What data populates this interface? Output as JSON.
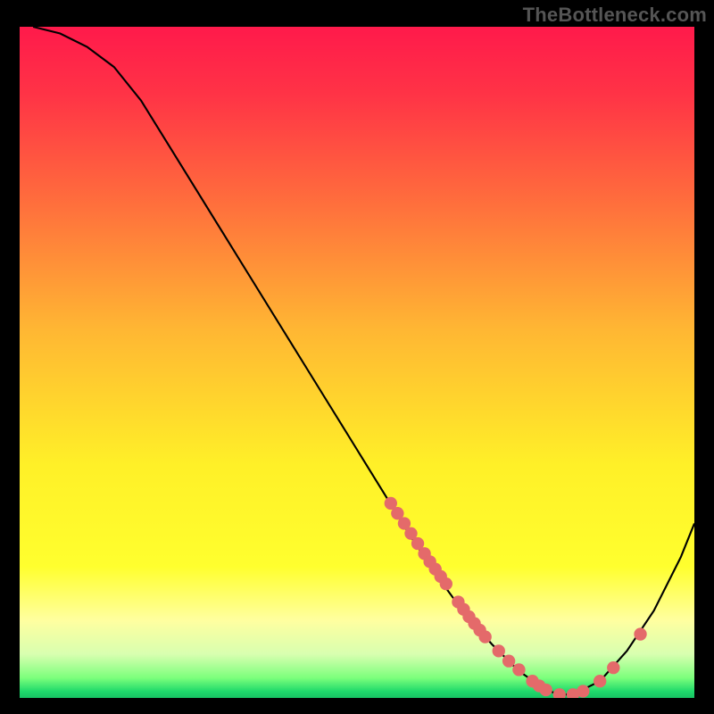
{
  "watermark": "TheBottleneck.com",
  "gradient_stops": [
    {
      "offset": 0.0,
      "color": "#ff1a4b"
    },
    {
      "offset": 0.1,
      "color": "#ff3346"
    },
    {
      "offset": 0.25,
      "color": "#ff6a3d"
    },
    {
      "offset": 0.45,
      "color": "#ffb733"
    },
    {
      "offset": 0.65,
      "color": "#fff028"
    },
    {
      "offset": 0.8,
      "color": "#ffff2e"
    },
    {
      "offset": 0.88,
      "color": "#ffffa0"
    },
    {
      "offset": 0.93,
      "color": "#d8ffb0"
    },
    {
      "offset": 0.965,
      "color": "#7cff7c"
    },
    {
      "offset": 0.985,
      "color": "#1fd96b"
    },
    {
      "offset": 1.0,
      "color": "#14b560"
    }
  ],
  "dot_color": "#e46a6a",
  "chart_data": {
    "type": "line",
    "title": "",
    "xlabel": "",
    "ylabel": "",
    "xlim": [
      0,
      100
    ],
    "ylim": [
      0,
      100
    ],
    "series": [
      {
        "name": "curve",
        "x": [
          2,
          6,
          10,
          14,
          18,
          22,
          26,
          30,
          34,
          38,
          42,
          46,
          50,
          54,
          58,
          62,
          66,
          70,
          74,
          78,
          80,
          82,
          86,
          90,
          94,
          98,
          100
        ],
        "y": [
          100,
          99,
          97,
          94,
          89,
          82.5,
          76,
          69.5,
          63,
          56.5,
          50,
          43.5,
          37,
          30.5,
          24,
          18,
          12.5,
          8,
          4,
          1.2,
          0.5,
          0.5,
          2.5,
          7,
          13,
          21,
          26
        ]
      }
    ],
    "dots": [
      {
        "x": 55,
        "y": 29.0
      },
      {
        "x": 56,
        "y": 27.5
      },
      {
        "x": 57,
        "y": 26.0
      },
      {
        "x": 58,
        "y": 24.5
      },
      {
        "x": 59,
        "y": 23.0
      },
      {
        "x": 60,
        "y": 21.5
      },
      {
        "x": 60.8,
        "y": 20.3
      },
      {
        "x": 61.6,
        "y": 19.2
      },
      {
        "x": 62.4,
        "y": 18.1
      },
      {
        "x": 63.2,
        "y": 17.0
      },
      {
        "x": 65.0,
        "y": 14.3
      },
      {
        "x": 65.8,
        "y": 13.2
      },
      {
        "x": 66.6,
        "y": 12.1
      },
      {
        "x": 67.4,
        "y": 11.1
      },
      {
        "x": 68.2,
        "y": 10.1
      },
      {
        "x": 69.0,
        "y": 9.1
      },
      {
        "x": 71.0,
        "y": 7.0
      },
      {
        "x": 72.5,
        "y": 5.5
      },
      {
        "x": 74.0,
        "y": 4.2
      },
      {
        "x": 76.0,
        "y": 2.5
      },
      {
        "x": 77.0,
        "y": 1.8
      },
      {
        "x": 78.0,
        "y": 1.2
      },
      {
        "x": 80.0,
        "y": 0.5
      },
      {
        "x": 82.0,
        "y": 0.5
      },
      {
        "x": 83.5,
        "y": 1.0
      },
      {
        "x": 86.0,
        "y": 2.5
      },
      {
        "x": 88.0,
        "y": 4.5
      },
      {
        "x": 92.0,
        "y": 9.5
      }
    ]
  }
}
